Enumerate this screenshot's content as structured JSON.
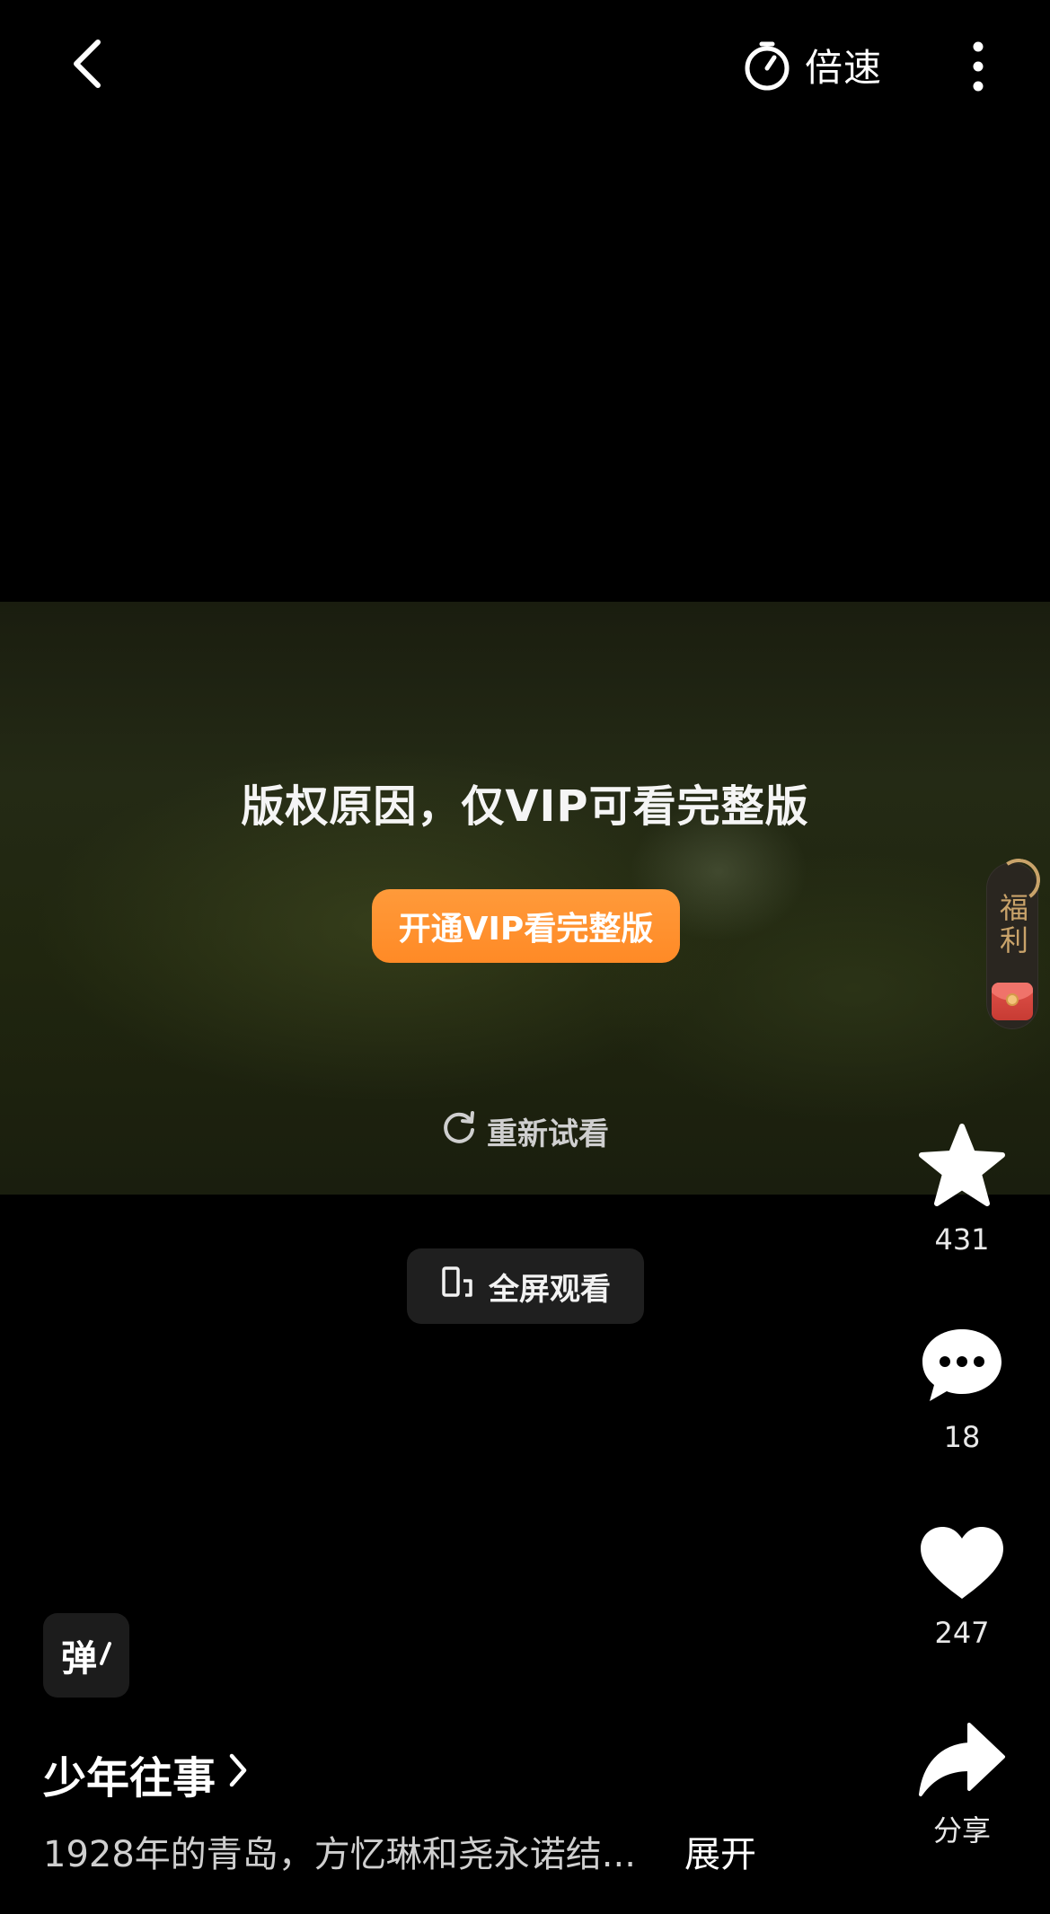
{
  "top_bar": {
    "back_icon": "chevron-left-icon",
    "speed_icon": "speedometer-icon",
    "speed_label": "倍速",
    "more_icon": "more-vertical-icon"
  },
  "player": {
    "message": "版权原因，仅VIP可看完整版",
    "vip_button_label": "开通VIP看完整版",
    "vip_button_color": "#ff8a26",
    "retry_icon": "refresh-icon",
    "retry_label": "重新试看",
    "fullscreen_icon": "rotate-screen-icon",
    "fullscreen_label": "全屏观看"
  },
  "welfare": {
    "label": "福利",
    "icon": "red-envelope-icon",
    "accent_color": "#c9a36a"
  },
  "actions": [
    {
      "name": "favorite",
      "icon": "star-icon",
      "count": "431"
    },
    {
      "name": "comment",
      "icon": "comment-icon",
      "count": "18"
    },
    {
      "name": "like",
      "icon": "heart-icon",
      "count": "247"
    },
    {
      "name": "share",
      "icon": "share-icon",
      "label": "分享"
    }
  ],
  "danmaku": {
    "label": "弹"
  },
  "info": {
    "title": "少年往事",
    "description": "1928年的青岛，方忆琳和尧永诺结...",
    "expand_label": "展开"
  }
}
